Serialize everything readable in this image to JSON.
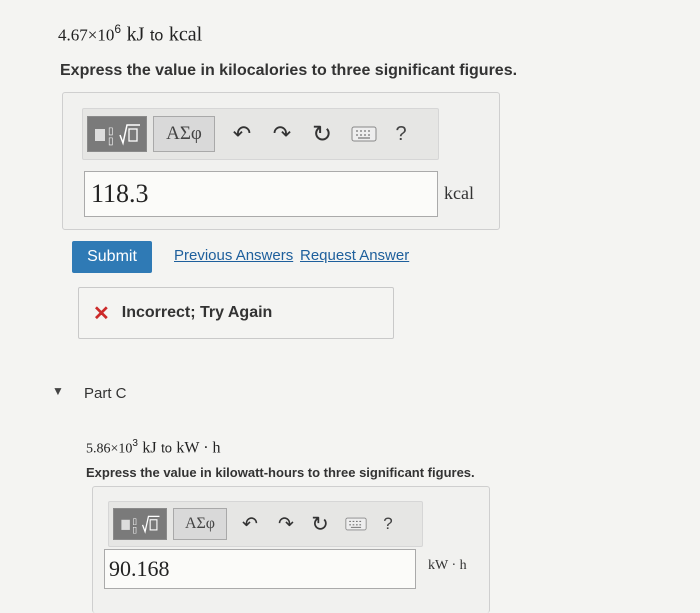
{
  "partB": {
    "problem": {
      "coef": "4.67×10",
      "exp": "6",
      "unit_from": "kJ",
      "to": "to",
      "unit_to": "kcal"
    },
    "instruction": "Express the value in kilocalories to three significant figures.",
    "toolbar": {
      "symbols_label": "ΑΣφ",
      "help_label": "?"
    },
    "answer_value": "118.3",
    "unit": "kcal",
    "submit_label": "Submit",
    "previous_answers_label": "Previous Answers",
    "request_answer_label": "Request Answer",
    "feedback": {
      "icon": "✕",
      "text": "Incorrect; Try Again"
    }
  },
  "partC": {
    "title": "Part C",
    "problem": {
      "coef": "5.86×10",
      "exp": "3",
      "unit_from": "kJ",
      "to": "to",
      "unit_to": "kW · h"
    },
    "instruction": "Express the value in kilowatt-hours to three significant figures.",
    "toolbar": {
      "symbols_label": "ΑΣφ",
      "help_label": "?"
    },
    "answer_value": "90.168",
    "unit": "kW · h"
  },
  "colors": {
    "accent": "#2f7ab5",
    "error": "#cc2a2a",
    "link": "#1e5f9c"
  }
}
